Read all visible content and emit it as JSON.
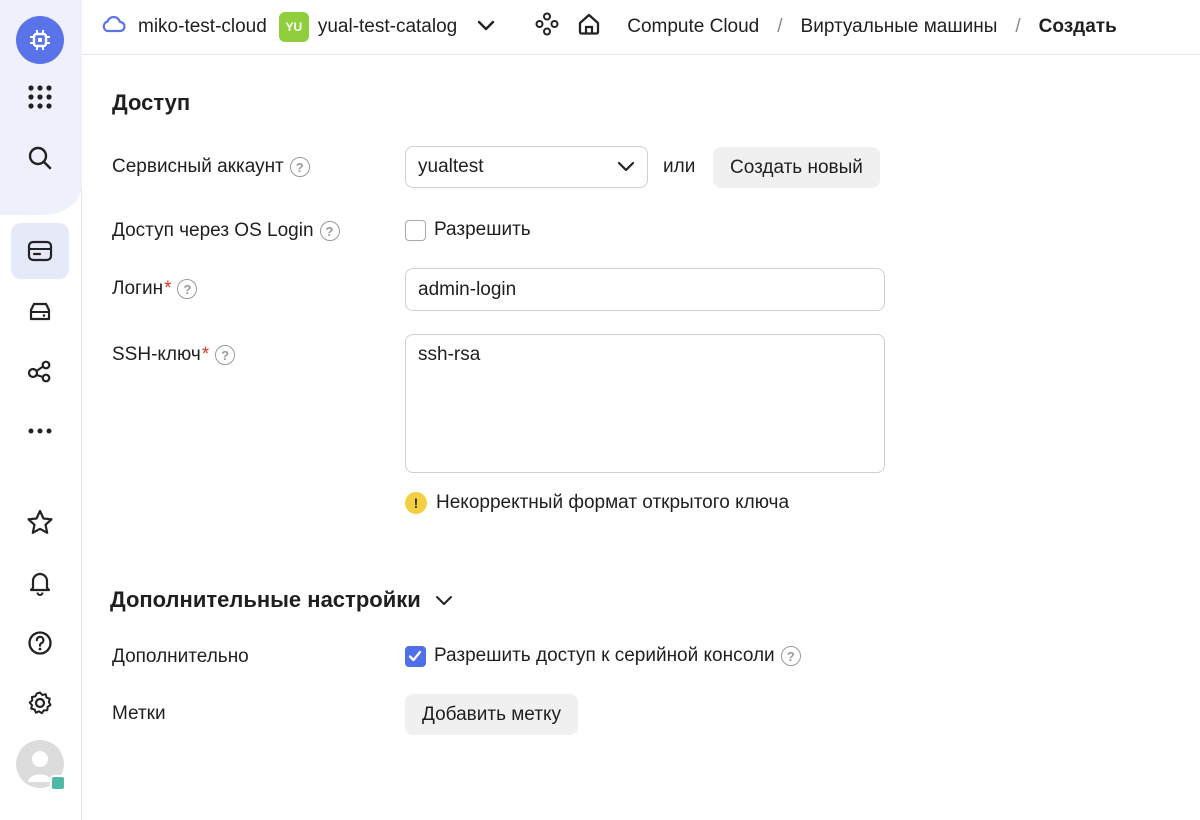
{
  "header": {
    "cloud_name": "miko-test-cloud",
    "folder_badge": "YU",
    "folder_name": "yual-test-catalog",
    "breadcrumb": [
      "Compute Cloud",
      "Виртуальные машины",
      "Создать"
    ],
    "separator": "/"
  },
  "access": {
    "title": "Доступ",
    "service_account_label": "Сервисный аккаунт",
    "service_account_value": "yualtest",
    "or_text": "или",
    "create_new_label": "Создать новый",
    "os_login_label": "Доступ через OS Login",
    "os_login_checkbox_label": "Разрешить",
    "os_login_checked": false,
    "login_label": "Логин",
    "login_value": "admin-login",
    "ssh_label": "SSH-ключ",
    "ssh_value": "ssh-rsa",
    "ssh_error": "Некорректный формат открытого ключа",
    "required_mark": "*",
    "help_glyph": "?",
    "warn_glyph": "!"
  },
  "additional": {
    "title": "Дополнительные настройки",
    "extra_label": "Дополнительно",
    "serial_console_label": "Разрешить доступ к серийной консоли",
    "serial_console_checked": true,
    "labels_label": "Метки",
    "add_label_button": "Добавить метку"
  },
  "colors": {
    "accent": "#5b73e8",
    "checkbox_checked": "#5070ea",
    "folder_badge": "#8fcf3d",
    "warning": "#f5cf42",
    "required": "#e03a2f"
  }
}
